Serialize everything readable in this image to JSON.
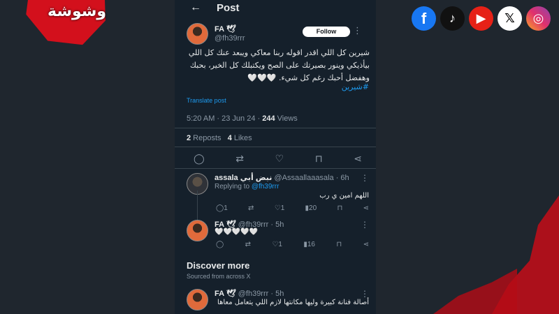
{
  "brand": {
    "logo_text": "وشوشة"
  },
  "social": [
    {
      "name": "facebook-icon",
      "glyph": "f",
      "cls": "s-fb"
    },
    {
      "name": "tiktok-icon",
      "glyph": "♪",
      "cls": "s-tt"
    },
    {
      "name": "youtube-icon",
      "glyph": "▶",
      "cls": "s-yt"
    },
    {
      "name": "x-icon",
      "glyph": "𝕏",
      "cls": "s-x"
    },
    {
      "name": "instagram-icon",
      "glyph": "◎",
      "cls": "s-ig"
    }
  ],
  "header": {
    "back_glyph": "←",
    "title": "Post"
  },
  "post": {
    "display_name": "FA 🕊",
    "handle": "@fh39rrr",
    "follow_label": "Follow",
    "kebab": "⋮",
    "text": "شيرين كل اللي اقدر اقوله ربنا معاكي ويبعد عنك كل اللي بيأذيكي وينور بصيرتك على الصح ويكتبلك كل الخير، بحبك وهفضل أحبك رغم كل شيء. 🤍🤍🤍",
    "hashtag": "#شيرين",
    "translate_label": "Translate post",
    "time": "5:20 AM · 23 Jun 24 · ",
    "views_count": "244",
    "views_label": " Views",
    "reposts_count": "2",
    "reposts_label": " Reposts",
    "likes_count": "4",
    "likes_label": " Likes"
  },
  "actions": {
    "reply": "◯",
    "repost": "⇄",
    "like": "♡",
    "bookmark": "⊓",
    "share": "⋖"
  },
  "replies": [
    {
      "name": "assala نبض أبي",
      "handle": "@Assaallaaasala · 6h",
      "replying_prefix": "Replying to ",
      "replying_to": "@fh39rrr",
      "text": "اللهم امين ي رب",
      "reply_count": "1",
      "like_count": "1",
      "views": "20"
    },
    {
      "name": "FA 🕊",
      "handle": "@fh39rrr · 5h",
      "text": "🤍🤍🤍🤍🤍",
      "like_count": "1",
      "views": "16"
    }
  ],
  "discover": {
    "title": "Discover more",
    "subtitle": "Sourced from across X",
    "item": {
      "name": "FA 🕊",
      "handle": "@fh39rrr · 5h",
      "text": "أصالة فنانة كبيرة وليها مكانتها لازم اللي يتعامل معاها"
    }
  }
}
